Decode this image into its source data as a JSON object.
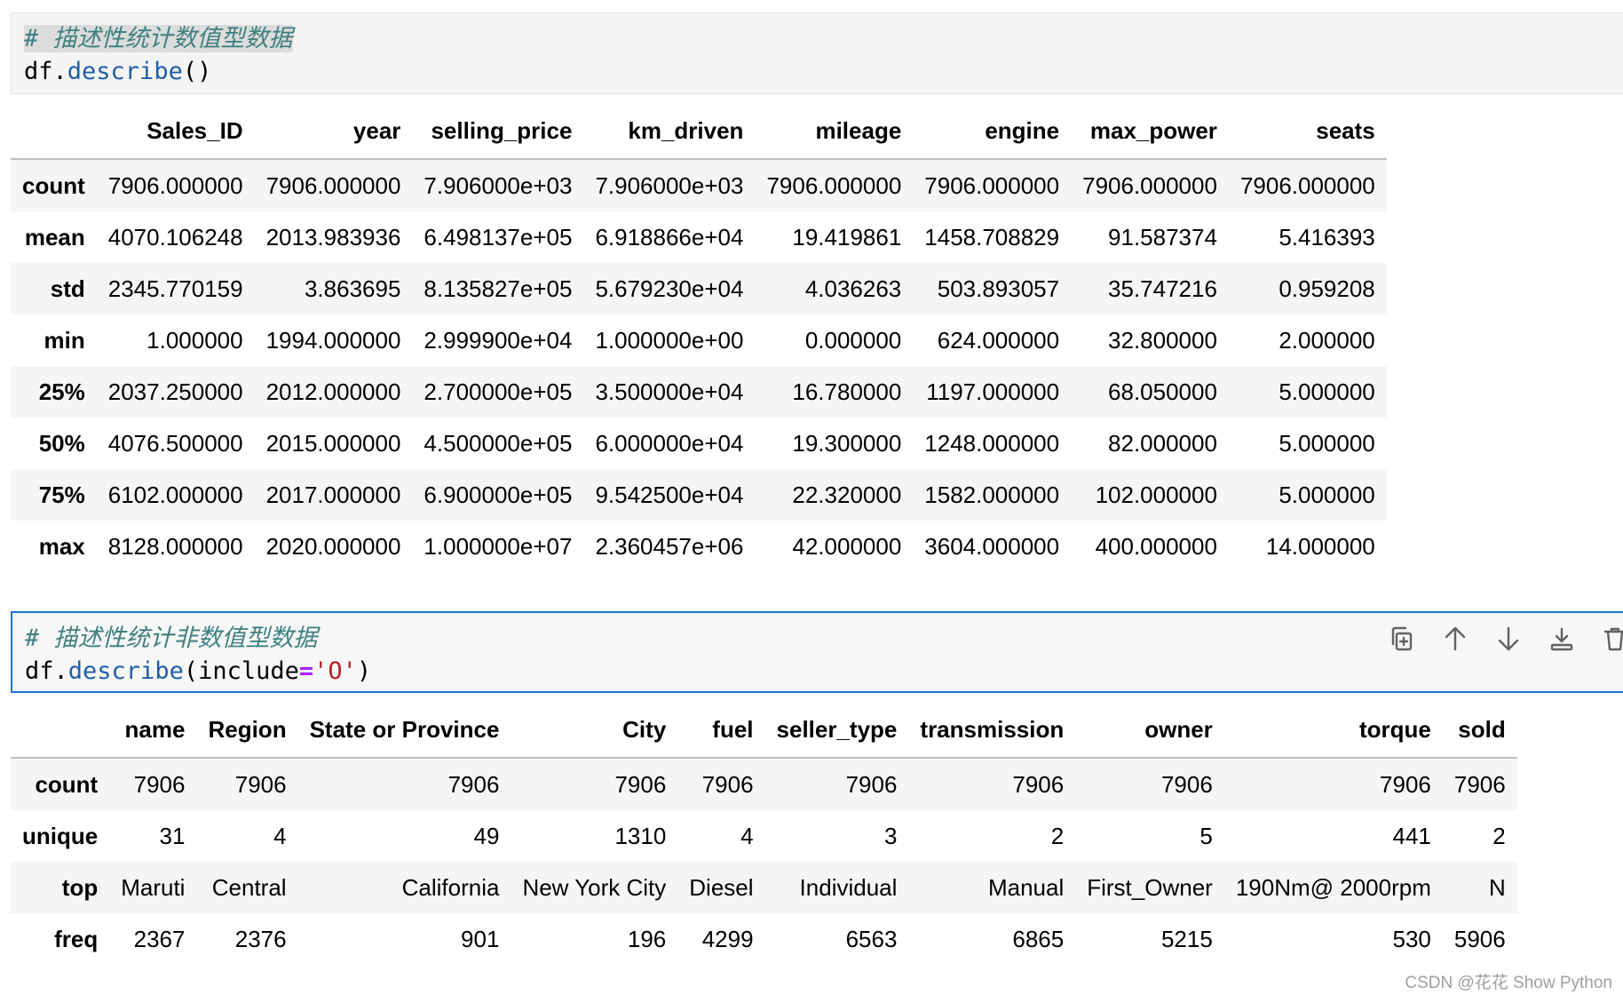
{
  "cell1": {
    "comment": "# 描述性统计数值型数据",
    "code_obj": "df.",
    "code_fn": "describe",
    "code_tail": "()"
  },
  "table1": {
    "columns": [
      "Sales_ID",
      "year",
      "selling_price",
      "km_driven",
      "mileage",
      "engine",
      "max_power",
      "seats"
    ],
    "rows": [
      {
        "label": "count",
        "values": [
          "7906.000000",
          "7906.000000",
          "7.906000e+03",
          "7.906000e+03",
          "7906.000000",
          "7906.000000",
          "7906.000000",
          "7906.000000"
        ]
      },
      {
        "label": "mean",
        "values": [
          "4070.106248",
          "2013.983936",
          "6.498137e+05",
          "6.918866e+04",
          "19.419861",
          "1458.708829",
          "91.587374",
          "5.416393"
        ]
      },
      {
        "label": "std",
        "values": [
          "2345.770159",
          "3.863695",
          "8.135827e+05",
          "5.679230e+04",
          "4.036263",
          "503.893057",
          "35.747216",
          "0.959208"
        ]
      },
      {
        "label": "min",
        "values": [
          "1.000000",
          "1994.000000",
          "2.999900e+04",
          "1.000000e+00",
          "0.000000",
          "624.000000",
          "32.800000",
          "2.000000"
        ]
      },
      {
        "label": "25%",
        "values": [
          "2037.250000",
          "2012.000000",
          "2.700000e+05",
          "3.500000e+04",
          "16.780000",
          "1197.000000",
          "68.050000",
          "5.000000"
        ]
      },
      {
        "label": "50%",
        "values": [
          "4076.500000",
          "2015.000000",
          "4.500000e+05",
          "6.000000e+04",
          "19.300000",
          "1248.000000",
          "82.000000",
          "5.000000"
        ]
      },
      {
        "label": "75%",
        "values": [
          "6102.000000",
          "2017.000000",
          "6.900000e+05",
          "9.542500e+04",
          "22.320000",
          "1582.000000",
          "102.000000",
          "5.000000"
        ]
      },
      {
        "label": "max",
        "values": [
          "8128.000000",
          "2020.000000",
          "1.000000e+07",
          "2.360457e+06",
          "42.000000",
          "3604.000000",
          "400.000000",
          "14.000000"
        ]
      }
    ]
  },
  "cell2": {
    "comment": "# 描述性统计非数值型数据",
    "code_obj": "df.",
    "code_fn": "describe",
    "code_open": "(include",
    "code_op": "=",
    "code_str": "'O'",
    "code_close": ")"
  },
  "toolbar": [
    {
      "name": "copy-icon"
    },
    {
      "name": "move-up-icon"
    },
    {
      "name": "move-down-icon"
    },
    {
      "name": "insert-below-icon"
    },
    {
      "name": "delete-icon"
    }
  ],
  "table2": {
    "columns": [
      "name",
      "Region",
      "State or Province",
      "City",
      "fuel",
      "seller_type",
      "transmission",
      "owner",
      "torque",
      "sold"
    ],
    "rows": [
      {
        "label": "count",
        "values": [
          "7906",
          "7906",
          "7906",
          "7906",
          "7906",
          "7906",
          "7906",
          "7906",
          "7906",
          "7906"
        ]
      },
      {
        "label": "unique",
        "values": [
          "31",
          "4",
          "49",
          "1310",
          "4",
          "3",
          "2",
          "5",
          "441",
          "2"
        ]
      },
      {
        "label": "top",
        "values": [
          "Maruti",
          "Central",
          "California",
          "New York City",
          "Diesel",
          "Individual",
          "Manual",
          "First_Owner",
          "190Nm@ 2000rpm",
          "N"
        ]
      },
      {
        "label": "freq",
        "values": [
          "2367",
          "2376",
          "901",
          "196",
          "4299",
          "6563",
          "6865",
          "5215",
          "530",
          "5906"
        ]
      }
    ]
  },
  "watermark": "CSDN @花花 Show Python"
}
